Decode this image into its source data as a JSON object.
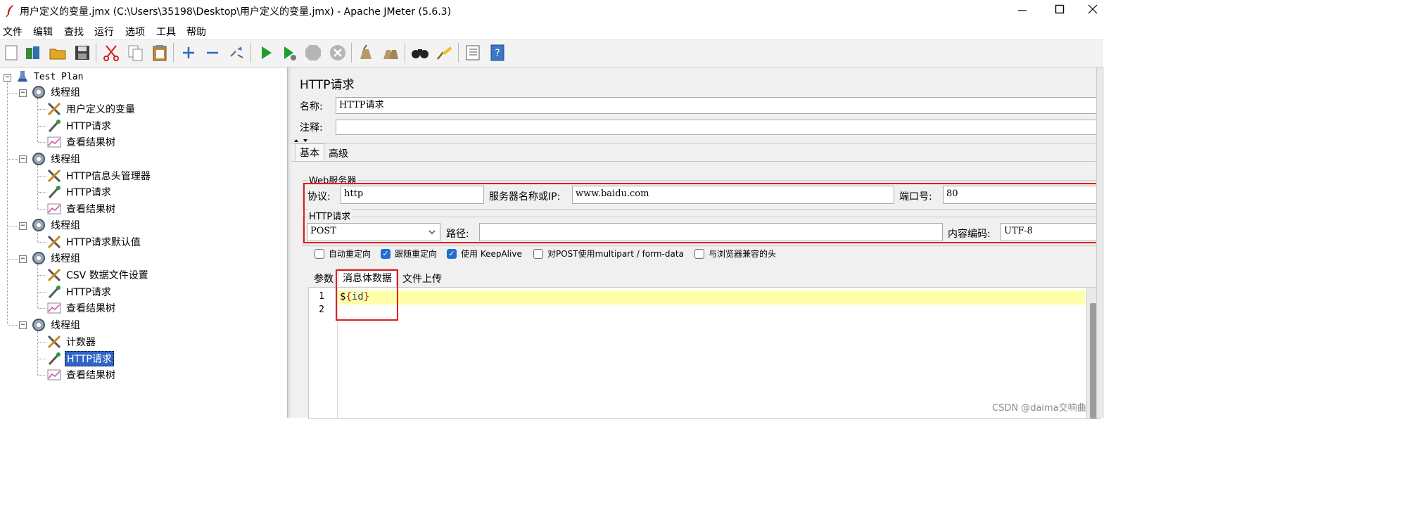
{
  "window": {
    "title": "用户定义的变量.jmx (C:\\Users\\35198\\Desktop\\用户定义的变量.jmx) - Apache JMeter (5.6.3)"
  },
  "menu": [
    "文件",
    "编辑",
    "查找",
    "运行",
    "选项",
    "工具",
    "帮助"
  ],
  "toolbar_icons": [
    "new-icon",
    "templates-icon",
    "open-icon",
    "save-icon",
    "cut-icon",
    "copy-icon",
    "paste-icon",
    "expand-icon",
    "collapse-icon",
    "toggle-icon",
    "start-icon",
    "start-no-pause-icon",
    "stop-icon",
    "shutdown-icon",
    "clear-icon",
    "clear-all-icon",
    "search-icon",
    "reset-search-icon",
    "function-helper-icon",
    "help-icon"
  ],
  "tree": {
    "root": "Test Plan",
    "groups": [
      {
        "label": "线程组",
        "children": [
          "用户定义的变量",
          "HTTP请求",
          "查看结果树"
        ]
      },
      {
        "label": "线程组",
        "children": [
          "HTTP信息头管理器",
          "HTTP请求",
          "查看结果树"
        ]
      },
      {
        "label": "线程组",
        "children": [
          "HTTP请求默认值"
        ]
      },
      {
        "label": "线程组",
        "children": [
          "CSV 数据文件设置",
          "HTTP请求",
          "查看结果树"
        ]
      },
      {
        "label": "线程组",
        "children": [
          "计数器",
          "HTTP请求",
          "查看结果树"
        ]
      }
    ],
    "selected": "HTTP请求"
  },
  "panel": {
    "title": "HTTP请求",
    "name_label": "名称:",
    "name_value": "HTTP请求",
    "comment_label": "注释:",
    "comment_value": "",
    "tabs": [
      "基本",
      "高级"
    ],
    "web_server": {
      "legend": "Web服务器",
      "protocol_label": "协议:",
      "protocol_value": "http",
      "server_label": "服务器名称或IP:",
      "server_value": "www.baidu.com",
      "port_label": "端口号:",
      "port_value": "80"
    },
    "http_request": {
      "legend": "HTTP请求",
      "method": "POST",
      "path_label": "路径:",
      "path_value": "",
      "encoding_label": "内容编码:",
      "encoding_value": "UTF-8"
    },
    "options": [
      {
        "label": "自动重定向",
        "checked": false
      },
      {
        "label": "跟随重定向",
        "checked": true
      },
      {
        "label": "使用 KeepAlive",
        "checked": true
      },
      {
        "label": "对POST使用multipart / form-data",
        "checked": false
      },
      {
        "label": "与浏览器兼容的头",
        "checked": false
      }
    ],
    "body_tabs": [
      "参数",
      "消息体数据",
      "文件上传"
    ],
    "body_lines": [
      "1",
      "2"
    ],
    "body_code": {
      "prefix": "$",
      "open": "{",
      "var": "id",
      "close": "}"
    }
  },
  "watermark": "CSDN @daima交响曲",
  "colors": {
    "selection": "#2f65ca",
    "annotation": "#e51c1c",
    "highlight_line": "#ffffaa",
    "checkbox_checked": "#1f6fd0"
  }
}
